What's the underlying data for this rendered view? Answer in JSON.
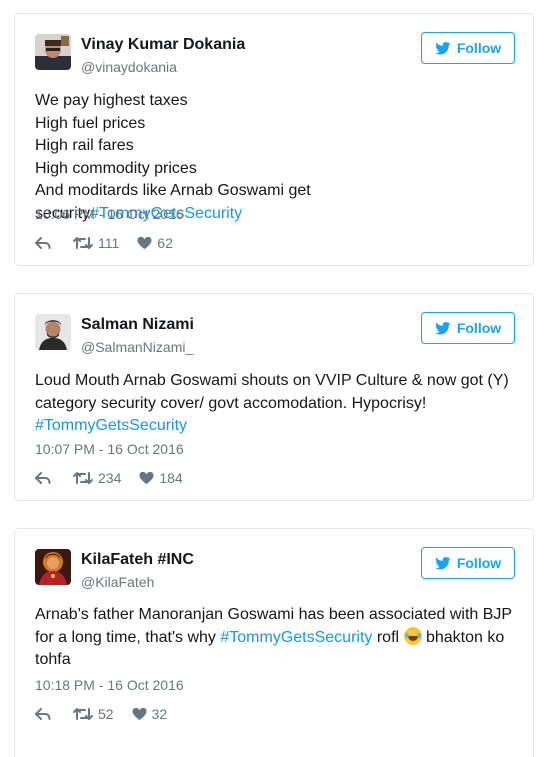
{
  "tweets": [
    {
      "name": "Vinay Kumar Dokania",
      "handle": "@vinaydokania",
      "follow_label": "Follow",
      "lines": [
        "We pay highest taxes",
        "High fuel prices",
        "High rail fares",
        "High commodity prices",
        "And moditards like Arnab Goswami get security"
      ],
      "hashtag": "#TommyGetsSecurity",
      "time": "10:06 PM - 16 Oct 2016",
      "retweets": "111",
      "likes": "62"
    },
    {
      "name": "Salman Nizami",
      "handle": "@SalmanNizami_",
      "follow_label": "Follow",
      "line1": "Loud Mouth Arnab Goswami shouts on VVIP Culture & now got (Y)",
      "line2": "category security cover/ govt accomodation. Hypocrisy!",
      "hashtag": "#TommyGetsSecurity",
      "time": "10:07 PM - 16 Oct 2016",
      "retweets": "234",
      "likes": "184"
    },
    {
      "name": "KilaFateh #INC",
      "handle": "@KilaFateh",
      "follow_label": "Follow",
      "line1": "Arnab's father Manoranjan Goswami has been associated with BJP",
      "line2_pre": "for a long time, that's why ",
      "hashtag": "#TommyGetsSecurity",
      "line2_post": " rofl ",
      "line2_end": " bhakton ko",
      "line3": "tohfa",
      "time": "10:18 PM - 16 Oct 2016",
      "retweets": "52",
      "likes": "32"
    }
  ],
  "colors": {
    "link": "#1b95e0",
    "follow": "#1da1f2",
    "meta": "#657786",
    "border": "#e1e8ed"
  },
  "icons": [
    "twitter-bird-icon",
    "reply-icon",
    "retweet-icon",
    "heart-icon",
    "tears-of-joy-emoji"
  ]
}
